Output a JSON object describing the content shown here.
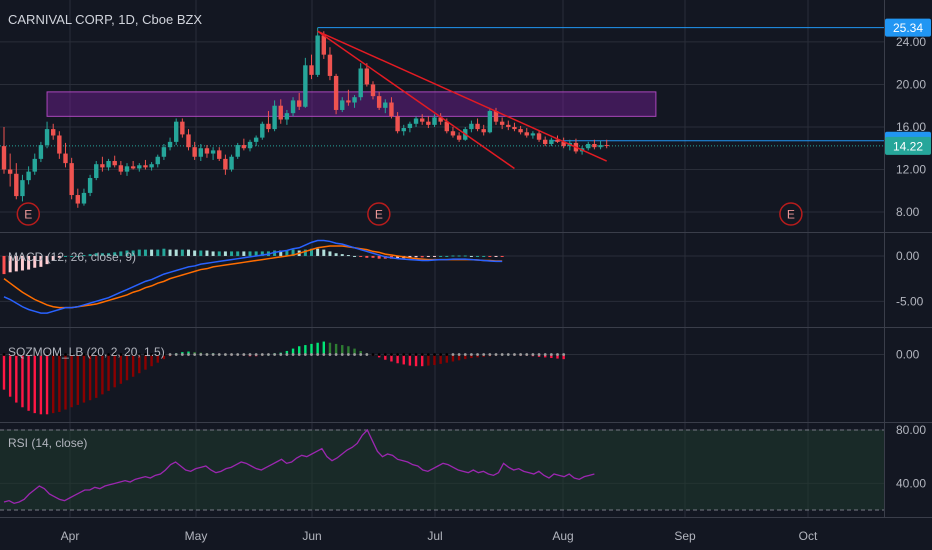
{
  "header": {
    "symbol_title": "CARNIVAL CORP, 1D, Cboe BZX"
  },
  "colors": {
    "background": "#131722",
    "grid": "#2a2e39",
    "up": "#26a69a",
    "down": "#ef5350",
    "macd_line": "#2962ff",
    "signal_line": "#ff6d00",
    "level_line": "#2196f3",
    "zone_fill": "#7b1fa2",
    "trendline": "#e31b23",
    "rsi_line": "#9c27b0",
    "rsi_band": "#1f3a2d"
  },
  "chart_data": [
    {
      "type": "candlestick",
      "title": "CARNIVAL CORP, 1D, Cboe BZX",
      "x_ticks": [
        "Apr",
        "May",
        "Jun",
        "Jul",
        "Aug",
        "Sep",
        "Oct"
      ],
      "y_ticks": [
        "24.00",
        "20.00",
        "16.00",
        "12.00",
        "8.00"
      ],
      "ylim": [
        6.5,
        27
      ],
      "ohlc": [
        [
          14.2,
          16.0,
          11.6,
          12.0
        ],
        [
          12.0,
          13.5,
          10.4,
          11.6
        ],
        [
          11.6,
          12.6,
          9.2,
          9.5
        ],
        [
          9.5,
          11.5,
          9.0,
          11.0
        ],
        [
          11.0,
          12.3,
          10.6,
          11.8
        ],
        [
          11.8,
          13.5,
          11.5,
          13.0
        ],
        [
          13.0,
          14.6,
          12.7,
          14.3
        ],
        [
          14.3,
          16.5,
          14.0,
          15.8
        ],
        [
          15.8,
          16.3,
          14.8,
          15.2
        ],
        [
          15.2,
          15.6,
          13.0,
          13.5
        ],
        [
          13.5,
          14.5,
          12.2,
          12.6
        ],
        [
          12.6,
          13.1,
          9.2,
          9.6
        ],
        [
          9.6,
          10.2,
          8.4,
          8.8
        ],
        [
          8.8,
          10.2,
          8.6,
          9.8
        ],
        [
          9.8,
          11.5,
          9.5,
          11.2
        ],
        [
          11.2,
          12.8,
          11.0,
          12.5
        ],
        [
          12.5,
          13.2,
          11.8,
          12.2
        ],
        [
          12.2,
          13.0,
          11.9,
          12.8
        ],
        [
          12.8,
          13.3,
          12.2,
          12.4
        ],
        [
          12.4,
          12.8,
          11.5,
          11.8
        ],
        [
          11.8,
          12.6,
          11.4,
          12.3
        ],
        [
          12.3,
          12.8,
          12.0,
          12.1
        ],
        [
          12.1,
          12.6,
          11.8,
          12.4
        ],
        [
          12.4,
          12.9,
          12.0,
          12.2
        ],
        [
          12.2,
          12.7,
          11.9,
          12.5
        ],
        [
          12.5,
          13.4,
          12.2,
          13.2
        ],
        [
          13.2,
          14.4,
          12.9,
          14.1
        ],
        [
          14.1,
          15.0,
          13.8,
          14.6
        ],
        [
          14.6,
          16.8,
          14.3,
          16.5
        ],
        [
          16.5,
          16.8,
          15.0,
          15.3
        ],
        [
          15.3,
          15.8,
          13.8,
          14.1
        ],
        [
          14.1,
          14.6,
          12.9,
          13.2
        ],
        [
          13.2,
          14.4,
          12.8,
          14.0
        ],
        [
          14.0,
          14.3,
          13.1,
          13.5
        ],
        [
          13.5,
          14.1,
          12.9,
          13.8
        ],
        [
          13.8,
          14.1,
          12.8,
          13.0
        ],
        [
          13.0,
          13.4,
          11.5,
          12.0
        ],
        [
          12.0,
          13.4,
          11.8,
          13.2
        ],
        [
          13.2,
          14.5,
          13.0,
          14.3
        ],
        [
          14.3,
          14.9,
          13.8,
          14.0
        ],
        [
          14.0,
          14.8,
          13.7,
          14.6
        ],
        [
          14.6,
          15.2,
          14.2,
          15.0
        ],
        [
          15.0,
          16.5,
          14.8,
          16.3
        ],
        [
          16.3,
          17.5,
          15.5,
          15.8
        ],
        [
          15.8,
          18.5,
          15.6,
          18.0
        ],
        [
          18.0,
          18.6,
          16.3,
          16.7
        ],
        [
          16.7,
          17.6,
          16.2,
          17.3
        ],
        [
          17.3,
          18.8,
          17.0,
          18.5
        ],
        [
          18.5,
          19.2,
          17.6,
          17.9
        ],
        [
          17.9,
          22.5,
          17.8,
          21.8
        ],
        [
          21.8,
          22.8,
          20.5,
          20.9
        ],
        [
          20.9,
          25.34,
          20.7,
          24.6
        ],
        [
          24.6,
          25.0,
          22.4,
          22.8
        ],
        [
          22.8,
          23.5,
          20.4,
          20.8
        ],
        [
          20.8,
          21.0,
          17.2,
          17.6
        ],
        [
          17.6,
          18.8,
          17.4,
          18.5
        ],
        [
          18.5,
          19.5,
          18.0,
          18.3
        ],
        [
          18.3,
          19.0,
          17.8,
          18.8
        ],
        [
          18.8,
          22.0,
          18.5,
          21.5
        ],
        [
          21.5,
          22.0,
          19.8,
          20.0
        ],
        [
          20.0,
          20.3,
          18.6,
          18.9
        ],
        [
          18.9,
          19.3,
          17.6,
          17.8
        ],
        [
          17.8,
          18.6,
          17.3,
          18.3
        ],
        [
          18.3,
          18.8,
          16.8,
          17.0
        ],
        [
          17.0,
          17.4,
          15.4,
          15.6
        ],
        [
          15.6,
          16.2,
          15.2,
          15.9
        ],
        [
          15.9,
          16.5,
          15.5,
          16.3
        ],
        [
          16.3,
          17.0,
          16.0,
          16.8
        ],
        [
          16.8,
          17.2,
          16.2,
          16.5
        ],
        [
          16.5,
          17.0,
          15.9,
          16.2
        ],
        [
          16.2,
          17.2,
          16.0,
          16.9
        ],
        [
          16.9,
          17.3,
          16.2,
          16.5
        ],
        [
          16.5,
          16.8,
          15.4,
          15.6
        ],
        [
          15.6,
          16.0,
          15.0,
          15.2
        ],
        [
          15.2,
          15.5,
          14.6,
          14.8
        ],
        [
          14.8,
          16.0,
          14.7,
          15.8
        ],
        [
          15.8,
          16.6,
          15.5,
          16.3
        ],
        [
          16.3,
          16.8,
          15.6,
          15.8
        ],
        [
          15.8,
          16.2,
          15.2,
          15.5
        ],
        [
          15.5,
          17.8,
          15.4,
          17.5
        ],
        [
          17.5,
          17.8,
          16.2,
          16.5
        ],
        [
          16.5,
          16.9,
          15.8,
          16.2
        ],
        [
          16.2,
          16.6,
          15.7,
          16.0
        ],
        [
          16.0,
          16.4,
          15.6,
          15.8
        ],
        [
          15.8,
          16.1,
          15.3,
          15.5
        ],
        [
          15.5,
          15.9,
          15.0,
          15.2
        ],
        [
          15.2,
          15.6,
          14.9,
          15.4
        ],
        [
          15.4,
          15.7,
          14.6,
          14.8
        ],
        [
          14.8,
          15.1,
          14.2,
          14.4
        ],
        [
          14.4,
          15.0,
          14.2,
          14.8
        ],
        [
          14.8,
          15.2,
          14.5,
          14.6
        ],
        [
          14.6,
          15.0,
          14.0,
          14.2
        ],
        [
          14.2,
          14.8,
          13.8,
          14.5
        ],
        [
          14.5,
          14.9,
          13.5,
          13.7
        ],
        [
          13.7,
          14.2,
          13.4,
          14.0
        ],
        [
          14.0,
          14.6,
          13.8,
          14.4
        ],
        [
          14.4,
          14.8,
          13.9,
          14.1
        ],
        [
          14.1,
          14.7,
          13.9,
          14.3
        ],
        [
          14.3,
          14.8,
          14.0,
          14.22
        ]
      ],
      "price_levels": [
        {
          "value": 25.34,
          "label": "25.34",
          "style": "solid"
        },
        {
          "value": 14.7,
          "label": "14.70",
          "style": "solid"
        },
        {
          "value": 14.22,
          "label": "14.22",
          "style": "dotted"
        }
      ],
      "zone": {
        "low": 17.0,
        "high": 19.3
      },
      "trendlines": [
        {
          "from_bar": 51,
          "from_price": 25.0,
          "to_bar": 98,
          "to_price": 12.8
        },
        {
          "from_bar": 51,
          "from_price": 25.0,
          "to_bar": 83,
          "to_price": 12.1
        }
      ],
      "earnings_markers": [
        {
          "bar": 2,
          "label": "E"
        },
        {
          "bar": 59,
          "label": "E"
        },
        {
          "bar": 126,
          "label": "E"
        }
      ]
    },
    {
      "type": "line",
      "title": "MACD (12, 26, close, 9)",
      "y_ticks": [
        "0.00",
        "-5.00"
      ],
      "ylim": [
        -7.5,
        2.2
      ],
      "series": [
        {
          "values": [
            -4.5,
            -4.8,
            -5.2,
            -5.6,
            -5.9,
            -6.1,
            -6.3,
            -6.3,
            -6.1,
            -5.9,
            -5.7,
            -5.7,
            -5.6,
            -5.4,
            -5.2,
            -5.0,
            -4.8,
            -4.6,
            -4.3,
            -4.0,
            -3.7,
            -3.4,
            -3.1,
            -2.8,
            -2.6,
            -2.3,
            -2.0,
            -1.8,
            -1.6,
            -1.4,
            -1.2,
            -1.1,
            -0.9,
            -0.8,
            -0.7,
            -0.6,
            -0.5,
            -0.4,
            -0.3,
            -0.2,
            -0.1,
            0.0,
            0.1,
            0.2,
            0.4,
            0.5,
            0.6,
            0.8,
            0.9,
            1.2,
            1.5,
            1.7,
            1.7,
            1.6,
            1.4,
            1.3,
            1.1,
            0.9,
            0.7,
            0.5,
            0.3,
            0.1,
            -0.1,
            -0.2,
            -0.3,
            -0.35,
            -0.4,
            -0.45,
            -0.5,
            -0.5,
            -0.45,
            -0.4,
            -0.4,
            -0.35,
            -0.35,
            -0.35,
            -0.4,
            -0.45,
            -0.5,
            -0.55,
            -0.6,
            -0.6
          ]
        },
        {
          "values": [
            -2.5,
            -3.0,
            -3.5,
            -4.0,
            -4.4,
            -4.8,
            -5.1,
            -5.4,
            -5.6,
            -5.7,
            -5.7,
            -5.7,
            -5.6,
            -5.5,
            -5.4,
            -5.3,
            -5.1,
            -4.9,
            -4.7,
            -4.5,
            -4.3,
            -4.0,
            -3.8,
            -3.5,
            -3.3,
            -3.0,
            -2.8,
            -2.5,
            -2.3,
            -2.1,
            -1.9,
            -1.7,
            -1.5,
            -1.4,
            -1.2,
            -1.1,
            -1.0,
            -0.9,
            -0.8,
            -0.7,
            -0.6,
            -0.5,
            -0.4,
            -0.3,
            -0.2,
            -0.1,
            0.0,
            0.1,
            0.3,
            0.5,
            0.7,
            0.9,
            1.0,
            1.1,
            1.1,
            1.1,
            1.0,
            0.9,
            0.8,
            0.7,
            0.5,
            0.4,
            0.2,
            0.1,
            0.0,
            -0.1,
            -0.2,
            -0.3,
            -0.35,
            -0.4,
            -0.4,
            -0.4,
            -0.4,
            -0.4,
            -0.4,
            -0.4,
            -0.4,
            -0.45,
            -0.5,
            -0.5,
            -0.55,
            -0.55
          ]
        }
      ]
    },
    {
      "type": "bar",
      "title": "SQZMOM_LB (20, 2, 20, 1.5)",
      "y_ticks": [
        "0.00"
      ],
      "ylim": [
        -5.5,
        2.0
      ],
      "values": [
        -3.0,
        -3.6,
        -4.1,
        -4.5,
        -4.8,
        -5.0,
        -5.1,
        -5.1,
        -5.0,
        -4.9,
        -4.7,
        -4.5,
        -4.3,
        -4.1,
        -3.9,
        -3.7,
        -3.4,
        -3.1,
        -2.8,
        -2.5,
        -2.2,
        -1.9,
        -1.6,
        -1.3,
        -1.0,
        -0.7,
        -0.4,
        -0.15,
        0.1,
        0.2,
        0.25,
        0.2,
        0.15,
        0.1,
        0.1,
        0.05,
        0.0,
        -0.05,
        -0.05,
        -0.1,
        -0.15,
        -0.15,
        -0.1,
        0.0,
        0.1,
        0.15,
        0.3,
        0.5,
        0.7,
        0.8,
        0.9,
        1.0,
        1.1,
        1.0,
        0.9,
        0.8,
        0.7,
        0.5,
        0.3,
        0.1,
        -0.1,
        -0.25,
        -0.45,
        -0.6,
        -0.75,
        -0.85,
        -0.95,
        -1.0,
        -1.0,
        -0.95,
        -0.9,
        -0.8,
        -0.7,
        -0.6,
        -0.5,
        -0.4,
        -0.3,
        -0.25,
        -0.2,
        -0.15,
        -0.1,
        -0.05,
        0.0,
        -0.05,
        -0.1,
        -0.1,
        -0.15,
        -0.2,
        -0.25,
        -0.3,
        -0.35,
        -0.4
      ]
    },
    {
      "type": "line",
      "title": "RSI (14, close)",
      "y_ticks": [
        "80.00",
        "40.00"
      ],
      "ylim": [
        17,
        83
      ],
      "bands": [
        80,
        20
      ],
      "values": [
        26,
        27,
        25,
        26,
        28,
        32,
        35,
        38,
        36,
        32,
        30,
        28,
        27,
        29,
        31,
        33,
        35,
        35,
        37,
        36,
        38,
        39,
        40,
        41,
        42,
        41,
        43,
        44,
        45,
        44,
        46,
        47,
        50,
        54,
        56,
        53,
        50,
        49,
        51,
        52,
        53,
        50,
        48,
        49,
        51,
        52,
        54,
        56,
        55,
        53,
        51,
        50,
        52,
        54,
        56,
        58,
        55,
        56,
        59,
        61,
        60,
        62,
        64,
        66,
        60,
        57,
        59,
        62,
        65,
        67,
        70,
        76,
        80,
        72,
        64,
        60,
        62,
        61,
        58,
        57,
        56,
        54,
        53,
        50,
        49,
        51,
        53,
        55,
        54,
        52,
        50,
        49,
        48,
        50,
        48,
        49,
        47,
        46,
        48,
        55,
        52,
        50,
        51,
        49,
        48,
        47,
        49,
        46,
        44,
        47,
        46,
        45,
        47,
        44,
        43,
        45,
        46,
        47
      ]
    }
  ],
  "x_axis": {
    "labels": [
      "Apr",
      "May",
      "Jun",
      "Jul",
      "Aug",
      "Sep",
      "Oct"
    ]
  }
}
